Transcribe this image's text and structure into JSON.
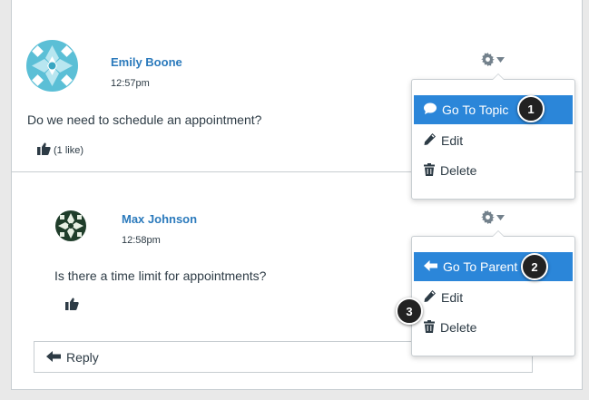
{
  "posts": [
    {
      "author": "Emily Boone",
      "time": "12:57pm",
      "message": "Do we need to schedule an appointment?",
      "likes_label": "(1 like)"
    },
    {
      "author": "Max Johnson",
      "time": "12:58pm",
      "message": "Is there a time limit for appointments?",
      "likes_label": ""
    }
  ],
  "menu1": {
    "items": [
      {
        "label": "Go To Topic",
        "icon": "chat-bubble-icon",
        "active": true
      },
      {
        "label": "Edit",
        "icon": "pencil-icon",
        "active": false
      },
      {
        "label": "Delete",
        "icon": "trash-icon",
        "active": false
      }
    ]
  },
  "menu2": {
    "items": [
      {
        "label": "Go To Parent",
        "icon": "arrow-left-icon",
        "active": true
      },
      {
        "label": "Edit",
        "icon": "pencil-icon",
        "active": false
      },
      {
        "label": "Delete",
        "icon": "trash-icon",
        "active": false
      }
    ]
  },
  "callouts": [
    "1",
    "2",
    "3"
  ],
  "reply": {
    "label": "Reply",
    "icon": "reply-arrow-icon"
  },
  "colors": {
    "accent": "#2b86d9",
    "author": "#2b7abc",
    "text": "#2d3b45",
    "border": "#c7cdd1"
  }
}
